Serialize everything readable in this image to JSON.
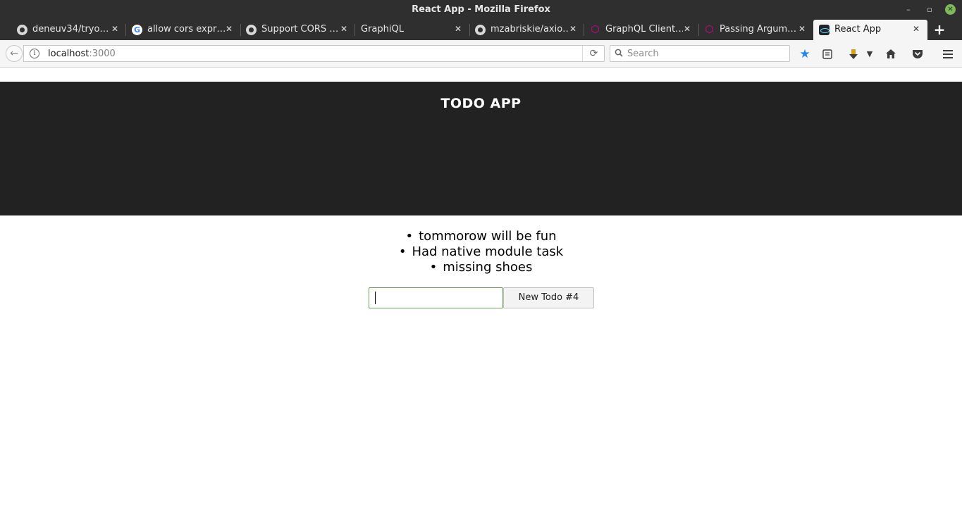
{
  "window": {
    "title": "React App - Mozilla Firefox",
    "controls": {
      "minimize": "–",
      "maximize": "▫",
      "close": "✕"
    }
  },
  "tabs": [
    {
      "label": "deneuv34/tryo…",
      "favicon": "github-icon",
      "active": false
    },
    {
      "label": "allow cors expr…",
      "favicon": "google-icon",
      "active": false
    },
    {
      "label": "Support CORS …",
      "favicon": "github-icon",
      "active": false
    },
    {
      "label": "GraphiQL",
      "favicon": "none",
      "active": false
    },
    {
      "label": "mzabriskie/axio…",
      "favicon": "github-icon",
      "active": false
    },
    {
      "label": "GraphQL Client…",
      "favicon": "graphql-icon",
      "active": false
    },
    {
      "label": "Passing Argum…",
      "favicon": "graphql-icon",
      "active": false
    },
    {
      "label": "React App",
      "favicon": "react-icon",
      "active": true
    }
  ],
  "tab_close_glyph": "✕",
  "new_tab_glyph": "+",
  "navbar": {
    "back_glyph": "←",
    "info_glyph": "i",
    "url_host": "localhost",
    "url_port": ":3000",
    "reload_glyph": "⟳",
    "search_placeholder": "Search",
    "toolbar_icons": [
      "star-icon",
      "reader-list-icon",
      "download-icon",
      "chevron-down-icon",
      "home-icon",
      "pocket-icon",
      "menu-icon"
    ]
  },
  "app": {
    "title": "TODO APP",
    "todos": [
      "tommorow will be fun",
      "Had native module task",
      "missing shoes"
    ],
    "input_value": "",
    "button_label": "New Todo #4"
  },
  "colors": {
    "chrome_dark": "#2f2f2f",
    "app_header": "#222222",
    "input_focus_border": "#6b9b57",
    "bookmark_star": "#1e88e5"
  }
}
